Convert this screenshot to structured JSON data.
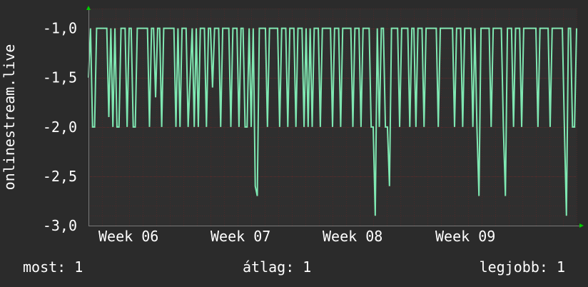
{
  "chart_data": {
    "type": "line",
    "ylabel": "onlinestream.live",
    "ylim": [
      -3.0,
      -0.8
    ],
    "y_ticks": [
      {
        "value": -1.0,
        "label": "-1,0"
      },
      {
        "value": -1.5,
        "label": "-1,5"
      },
      {
        "value": -2.0,
        "label": "-2,0"
      },
      {
        "value": -2.5,
        "label": "-2,5"
      },
      {
        "value": -3.0,
        "label": "-3,0"
      }
    ],
    "x_ticks": [
      "Week 06",
      "Week 07",
      "Week 08",
      "Week 09"
    ],
    "grid": true,
    "colors": {
      "background": "#2b2b2b",
      "plot_background": "#2f2f2f",
      "grid": "#4a2a2a",
      "line": "#7fe8b2",
      "axis_arrow": "#00cc00"
    },
    "series": [
      {
        "values": [
          -1.5,
          -1.0,
          -2.0,
          -2.0,
          -1.0,
          -1.0,
          -1.0,
          -1.0,
          -1.0,
          -1.0,
          -1.9,
          -1.0,
          -2.0,
          -1.0,
          -2.0,
          -2.0,
          -1.0,
          -1.0,
          -1.0,
          -2.0,
          -1.0,
          -1.0,
          -2.0,
          -2.0,
          -1.0,
          -1.0,
          -1.0,
          -1.0,
          -1.0,
          -1.0,
          -2.0,
          -1.0,
          -1.0,
          -1.7,
          -1.0,
          -1.0,
          -2.0,
          -1.0,
          -1.0,
          -1.0,
          -1.0,
          -1.0,
          -1.0,
          -2.0,
          -1.0,
          -2.0,
          -1.0,
          -1.0,
          -1.0,
          -2.0,
          -1.5,
          -1.0,
          -2.0,
          -1.0,
          -2.0,
          -1.0,
          -1.0,
          -1.0,
          -2.0,
          -1.0,
          -1.0,
          -1.6,
          -1.0,
          -1.0,
          -1.0,
          -2.0,
          -1.0,
          -1.0,
          -1.0,
          -1.0,
          -2.0,
          -1.0,
          -1.0,
          -1.0,
          -2.0,
          -1.0,
          -1.0,
          -2.0,
          -2.0,
          -1.0,
          -2.0,
          -1.0,
          -2.6,
          -2.7,
          -1.0,
          -1.0,
          -1.0,
          -1.0,
          -2.0,
          -1.0,
          -1.0,
          -1.0,
          -1.0,
          -1.0,
          -2.0,
          -1.0,
          -1.0,
          -1.0,
          -2.0,
          -1.0,
          -1.0,
          -1.0,
          -2.0,
          -1.0,
          -1.0,
          -1.0,
          -2.0,
          -1.0,
          -2.0,
          -1.0,
          -2.0,
          -1.0,
          -1.0,
          -1.0,
          -2.0,
          -1.0,
          -1.0,
          -1.0,
          -1.0,
          -1.0,
          -2.0,
          -1.0,
          -1.0,
          -1.0,
          -2.0,
          -1.0,
          -1.0,
          -1.0,
          -1.0,
          -1.0,
          -2.0,
          -1.0,
          -1.0,
          -1.0,
          -2.0,
          -1.0,
          -1.0,
          -1.0,
          -1.0,
          -2.0,
          -2.0,
          -2.9,
          -1.0,
          -2.0,
          -1.0,
          -1.0,
          -2.0,
          -2.0,
          -2.6,
          -1.0,
          -1.0,
          -1.0,
          -1.0,
          -2.0,
          -1.0,
          -1.0,
          -1.0,
          -1.0,
          -2.0,
          -1.0,
          -1.0,
          -2.0,
          -1.0,
          -1.0,
          -1.0,
          -2.0,
          -1.0,
          -1.0,
          -1.0,
          -1.0,
          -1.0,
          -1.0,
          -2.0,
          -1.0,
          -1.0,
          -1.0,
          -1.0,
          -1.0,
          -1.0,
          -1.0,
          -2.0,
          -1.0,
          -1.0,
          -1.0,
          -2.0,
          -1.0,
          -1.0,
          -1.0,
          -1.0,
          -2.0,
          -1.0,
          -2.0,
          -2.7,
          -1.0,
          -1.0,
          -1.0,
          -1.0,
          -1.0,
          -2.0,
          -1.0,
          -1.0,
          -1.0,
          -1.0,
          -1.0,
          -2.0,
          -2.7,
          -1.0,
          -1.0,
          -1.0,
          -2.0,
          -1.0,
          -1.0,
          -1.0,
          -2.0,
          -1.0,
          -1.0,
          -1.0,
          -1.0,
          -1.0,
          -1.0,
          -1.0,
          -2.0,
          -1.0,
          -1.0,
          -1.0,
          -1.0,
          -1.0,
          -2.0,
          -1.0,
          -1.0,
          -1.0,
          -1.0,
          -1.0,
          -1.0,
          -2.0,
          -2.9,
          -1.0,
          -1.0,
          -2.0,
          -2.0,
          -1.0
        ]
      }
    ]
  },
  "stats": {
    "current": "most: 1",
    "average": "átlag: 1",
    "max": "legjobb: 1"
  }
}
